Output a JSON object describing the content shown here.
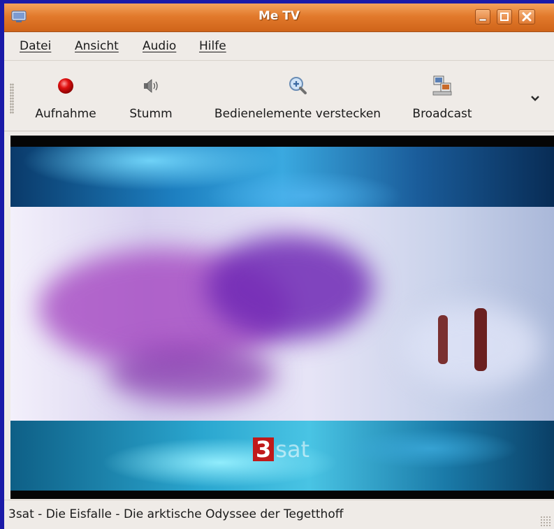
{
  "window": {
    "title": "Me TV",
    "icon": "tv-icon",
    "controls": [
      "minimize-icon",
      "maximize-icon",
      "close-icon"
    ]
  },
  "menubar": {
    "items": [
      {
        "label": "Datei"
      },
      {
        "label": "Ansicht"
      },
      {
        "label": "Audio"
      },
      {
        "label": "Hilfe"
      }
    ]
  },
  "toolbar": {
    "record": {
      "label": "Aufnahme",
      "icon": "record-icon",
      "color": "#e01010"
    },
    "mute": {
      "label": "Stumm",
      "icon": "speaker-icon"
    },
    "hide_controls": {
      "label": "Bedienelemente verstecken",
      "icon": "zoom-in-icon"
    },
    "broadcast": {
      "label": "Broadcast",
      "icon": "network-computers-icon"
    },
    "overflow_icon": "chevron-down-icon"
  },
  "video": {
    "channel_logo_number": "3",
    "channel_logo_text": "sat",
    "logo_color": "#c01a1a"
  },
  "statusbar": {
    "text": "3sat - Die Eisfalle - Die arktische Odyssee der Tegetthoff"
  }
}
